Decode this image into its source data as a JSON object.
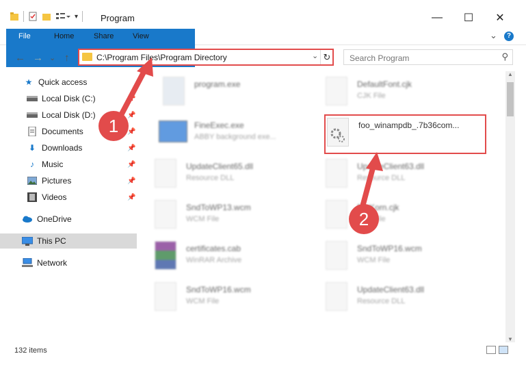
{
  "window": {
    "title": "Program",
    "controls": {
      "minimize": "—",
      "maximize": "☐",
      "close": "✕"
    }
  },
  "ribbon": {
    "tabs": [
      "File",
      "Home",
      "Share",
      "View"
    ],
    "expand": "⌄",
    "help": "?"
  },
  "nav": {
    "back": "←",
    "forward": "→",
    "recent": "⌄",
    "up": "↑",
    "address": "C:\\Program Files\\Program Directory",
    "refresh": "↻",
    "search_placeholder": "Search Program"
  },
  "sidebar": {
    "items": [
      {
        "label": "Quick access",
        "icon": "star-icon",
        "pinned": false
      },
      {
        "label": "Local Disk (C:)",
        "icon": "drive-icon",
        "pinned": true
      },
      {
        "label": "Local Disk (D:)",
        "icon": "drive-icon",
        "pinned": true
      },
      {
        "label": "Documents",
        "icon": "document-icon",
        "pinned": true
      },
      {
        "label": "Downloads",
        "icon": "download-icon",
        "pinned": true
      },
      {
        "label": "Music",
        "icon": "music-icon",
        "pinned": true
      },
      {
        "label": "Pictures",
        "icon": "pictures-icon",
        "pinned": true
      },
      {
        "label": "Videos",
        "icon": "video-icon",
        "pinned": true
      },
      {
        "label": "OneDrive",
        "icon": "cloud-icon",
        "pinned": false
      },
      {
        "label": "This PC",
        "icon": "computer-icon",
        "pinned": false,
        "selected": true
      },
      {
        "label": "Network",
        "icon": "network-icon",
        "pinned": false
      }
    ]
  },
  "files": [
    {
      "name": "program.exe",
      "type": ""
    },
    {
      "name": "DefaultFont.cjk",
      "type": "CJK File"
    },
    {
      "name": "FineExec.exe",
      "type": "ABBY background exe..."
    },
    {
      "name": "foo_winampdb_.7b36com...",
      "type": ""
    },
    {
      "name": "UpdateClient65.dll",
      "type": "Resource DLL"
    },
    {
      "name": "UpdateClient63.dll",
      "type": "Resource DLL"
    },
    {
      "name": "SndToWP13.wcm",
      "type": "WCM File"
    },
    {
      "name": "EntKorn.cjk",
      "type": "CJK File"
    },
    {
      "name": "certificates.cab",
      "type": "WinRAR Archive"
    },
    {
      "name": "SndToWP16.wcm",
      "type": "WCM File"
    },
    {
      "name": "SndToWP16.wcm",
      "type": "WCM File"
    },
    {
      "name": "UpdateClient63.dll",
      "type": "Resource DLL"
    }
  ],
  "status": {
    "count": "132 items"
  },
  "annotations": {
    "step1": "1",
    "step2": "2",
    "accent": "#e24b4b"
  }
}
